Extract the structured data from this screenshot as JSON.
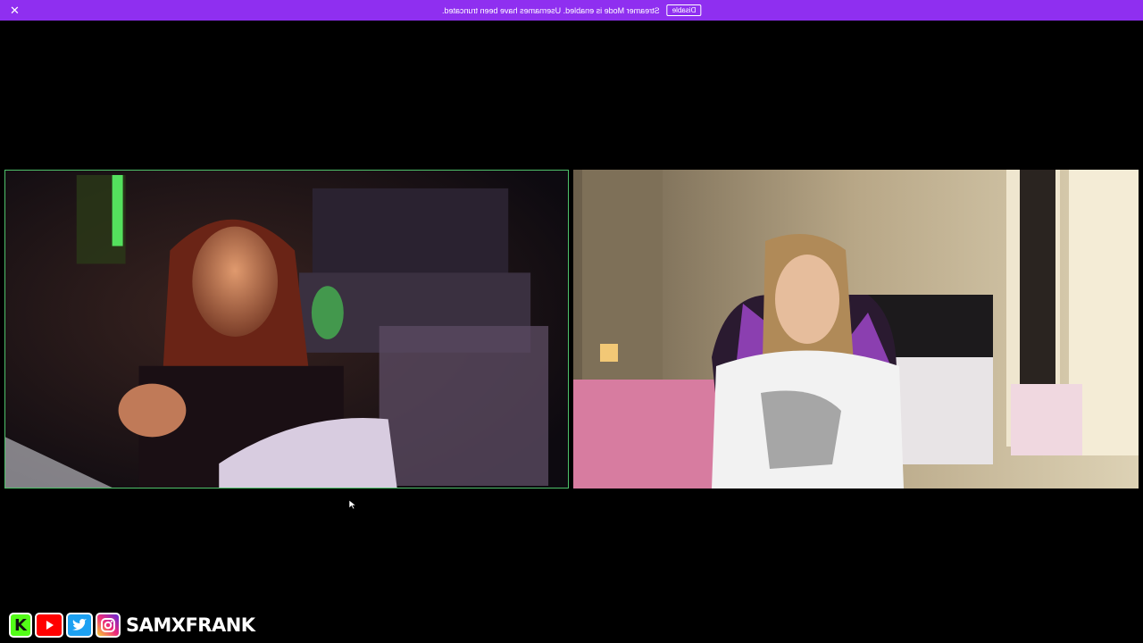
{
  "banner": {
    "message": "Streamer Mode is enabled. Usernames have been truncated.",
    "disable_label": "Disable",
    "close_symbol": "✕",
    "background": "#8f2ff0"
  },
  "tiles": {
    "left_border_color": "#4fc26b"
  },
  "socials": {
    "icons": [
      "kick-icon",
      "youtube-icon",
      "twitter-icon",
      "instagram-icon"
    ],
    "kick_letter": "K",
    "handle": "SAMXFRANK"
  }
}
